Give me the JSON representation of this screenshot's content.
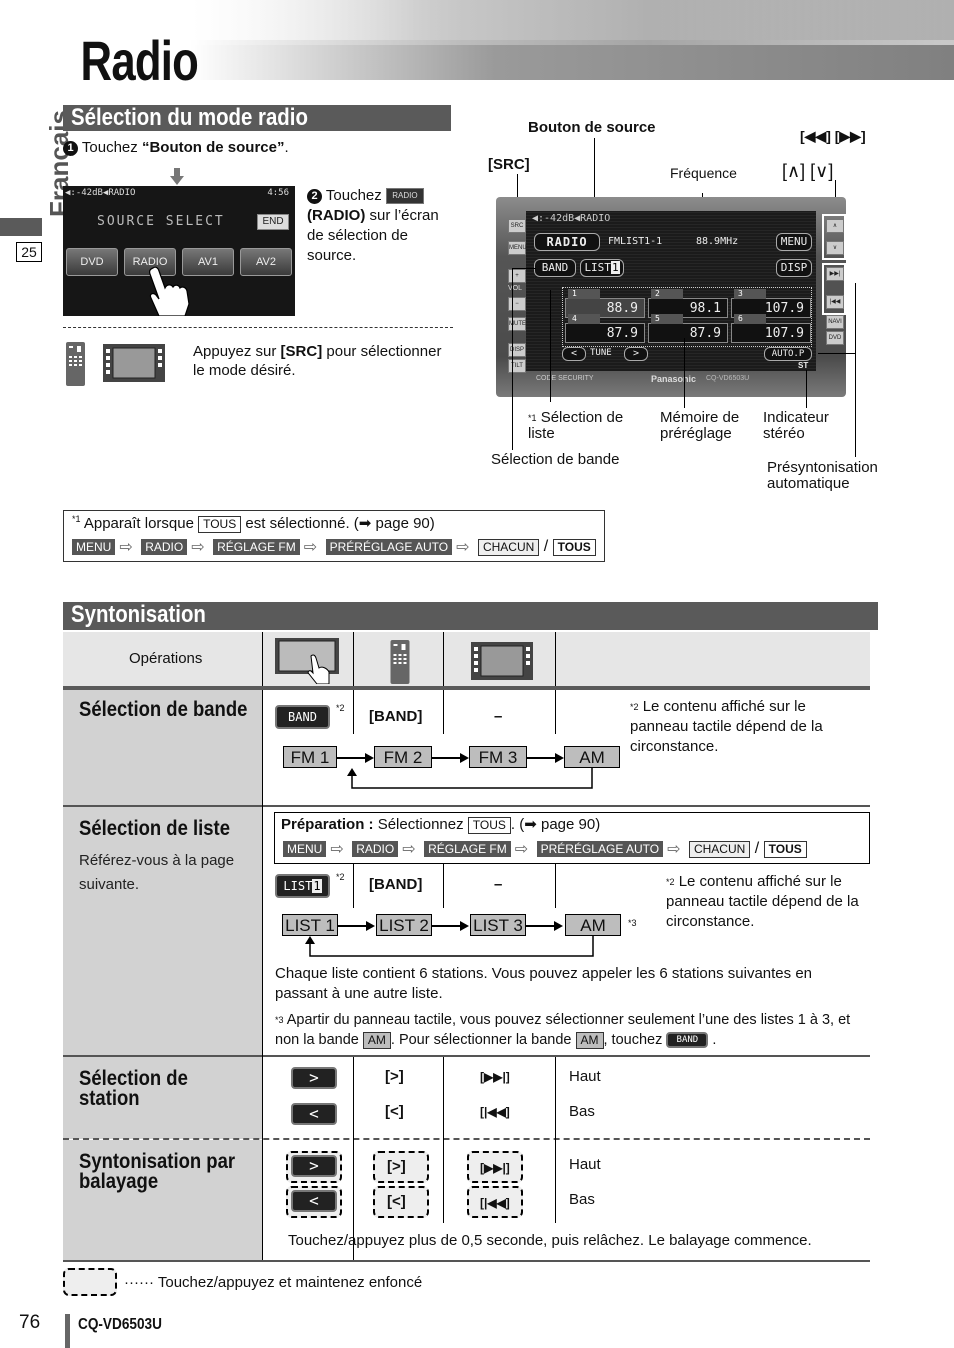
{
  "header": {
    "title": "Radio",
    "language_tab": "Français",
    "section_number": "25"
  },
  "section1": {
    "title": "Sélection du mode radio",
    "step1": {
      "num": "1",
      "prefix": "Touchez ",
      "bold": "“Bouton de source”",
      "suffix": "."
    },
    "source_screen": {
      "status": "◀:-42dB◀RADIO",
      "time": "4:56",
      "title": "SOURCE SELECT",
      "end": "END",
      "buttons": [
        "DVD",
        "RADIO",
        "AV1",
        "AV2"
      ]
    },
    "step2": {
      "num": "2",
      "prefix": "Touchez ",
      "chip": "RADIO",
      "bold": "(RADIO)",
      "rest": " sur l’écran de sélection de source."
    },
    "src_instruction": {
      "prefix": "Appuyez sur ",
      "bold": "[SRC]",
      "suffix": " pour sélectionner le mode désiré."
    }
  },
  "device_diagram": {
    "labels": {
      "bouton_source": "Bouton de source",
      "src": "[SRC]",
      "frequence": "Fréquence",
      "skip": "[◀◀] [▶▶]",
      "updown": "[∧] [∨]",
      "liste": "Sélection de liste",
      "liste_mark": "*1",
      "memoire": "Mémoire de préréglage",
      "stereo": "Indicateur stéréo",
      "bande": "Sélection de bande",
      "auto": "Présyntonisation automatique"
    },
    "screen": {
      "status": "◀:-42dB◀RADIO",
      "source": "RADIO",
      "list_info": "FMLIST1-1",
      "frequency": "88.9MHz",
      "menu": "MENU",
      "band": "BAND",
      "list": "LIST",
      "list_num": "1",
      "disp": "DISP",
      "presets": [
        {
          "n": "1",
          "f": "88.9"
        },
        {
          "n": "2",
          "f": "98.1"
        },
        {
          "n": "3",
          "f": "107.9"
        },
        {
          "n": "4",
          "f": "87.9"
        },
        {
          "n": "5",
          "f": "87.9"
        },
        {
          "n": "6",
          "f": "107.9"
        }
      ],
      "tune": "TUNE",
      "tune_prev": "<",
      "tune_next": ">",
      "auto_p": "AUTO.P",
      "st": "ST",
      "brand": "Panasonic",
      "model": "CQ-VD6503U",
      "code_security": "CODE SECURITY",
      "left_buttons": [
        "SRC",
        "MENU",
        "+",
        "VOL",
        "−",
        "MUTE",
        "DISP",
        "TILT"
      ],
      "right_buttons": [
        "∧",
        "∨",
        "▶▶|",
        "|◀◀",
        "NAVI",
        "DVD"
      ]
    }
  },
  "footnote1": {
    "mark": "*1",
    "prefix": "Apparaît lorsque",
    "chip": "TOUS",
    "suffix": "est sélectionné. (➡ page 90)",
    "path": [
      "MENU",
      "RADIO",
      "RÉGLAGE FM",
      "PRÉRÉGLAGE AUTO"
    ],
    "chacun": "CHACUN",
    "sep": "/",
    "tous": "TOUS"
  },
  "section2": {
    "title": "Syntonisation",
    "operations_label": "Opérations",
    "rows": {
      "bande": {
        "label": "Sélection de bande",
        "touch": "BAND",
        "touch_mark": "*2",
        "remote": "[BAND]",
        "panel": "–",
        "note_mark": "*2",
        "note": "Le contenu affiché sur le panneau tactile dépend de la circonstance.",
        "flow": [
          "FM 1",
          "FM 2",
          "FM 3",
          "AM"
        ]
      },
      "liste": {
        "label": "Sélection de liste",
        "sub": "Référez-vous à la page suivante.",
        "prep_bold": "Préparation :",
        "prep_text": "Sélectionnez",
        "prep_chip": "TOUS",
        "prep_suffix": ". (➡ page 90)",
        "path": [
          "MENU",
          "RADIO",
          "RÉGLAGE FM",
          "PRÉRÉGLAGE AUTO"
        ],
        "chacun": "CHACUN",
        "sep": "/",
        "tous": "TOUS",
        "touch": "LIST",
        "touch_num": "1",
        "touch_mark": "*2",
        "remote": "[BAND]",
        "panel": "–",
        "note_mark": "*2",
        "note": "Le contenu affiché sur le panneau tactile dépend de la circonstance.",
        "flow": [
          "LIST 1",
          "LIST 2",
          "LIST 3",
          "AM"
        ],
        "flow_mark": "*3",
        "para": "Chaque liste contient 6 stations. Vous pouvez appeler les 6 stations suivantes en passant à une autre liste.",
        "fn3_mark": "*3",
        "fn3_a": "Apartir du panneau tactile, vous pouvez sélectionner seulement l’une des listes 1 à 3, et non la bande",
        "fn3_chip1": "AM",
        "fn3_b": ". Pour sélectionner la bande",
        "fn3_chip2": "AM",
        "fn3_c": ", touchez",
        "fn3_btn": "BAND",
        "fn3_d": "."
      },
      "station": {
        "label": "Sélection de station",
        "up_touch": ">",
        "up_remote": "[>]",
        "up_panel": "[▶▶|]",
        "up_text": "Haut",
        "down_touch": "<",
        "down_remote": "[<]",
        "down_panel": "[|◀◀]",
        "down_text": "Bas"
      },
      "balayage": {
        "label": "Syntonisation par balayage",
        "up_touch": ">",
        "up_remote": "[>]",
        "up_panel": "[▶▶|]",
        "up_text": "Haut",
        "down_touch": "<",
        "down_remote": "[<]",
        "down_panel": "[|◀◀]",
        "down_text": "Bas",
        "note": "Touchez/appuyez plus de 0,5 seconde, puis relâchez. Le balayage commence."
      }
    }
  },
  "legend": {
    "text": "······ Touchez/appuyez et maintenez enfoncé"
  },
  "footer": {
    "page": "76",
    "model": "CQ-VD6503U"
  }
}
